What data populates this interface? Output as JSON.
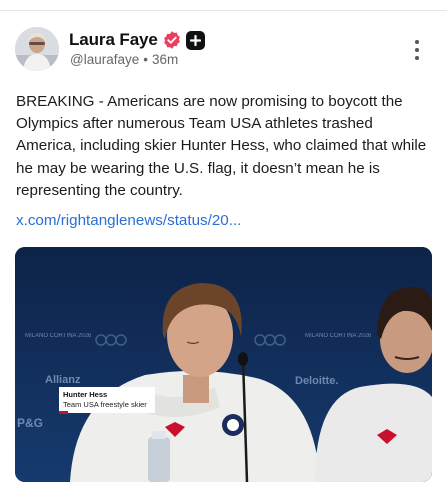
{
  "post": {
    "author": {
      "name": "Laura Faye",
      "handle": "@laurafaye",
      "separator": "•",
      "time": "36m",
      "verified_icon": "verified-badge-icon",
      "plus_icon": "plus-badge-icon"
    },
    "menu_icon": "more-vertical-icon",
    "text": "BREAKING - Americans are now promising to boycott the Olympics after numerous Team USA athletes trashed America, including skier Hunter Hess, who claimed that while he may be wearing the U.S. flag, it doesn’t mean he is representing the country.",
    "link": "x.com/rightanglenews/status/20..."
  },
  "media": {
    "caption_name": "Hunter Hess",
    "caption_role": "Team USA freestyle skier",
    "backdrop_texts": [
      "MILANO CORTINA 2026",
      "MILANO CORTINA 2026",
      "Allianz",
      "Deloitte.",
      "P&G"
    ]
  },
  "colors": {
    "verified": "#e8415f",
    "link": "#2a6fd6",
    "backdrop": "#0f2a52"
  }
}
